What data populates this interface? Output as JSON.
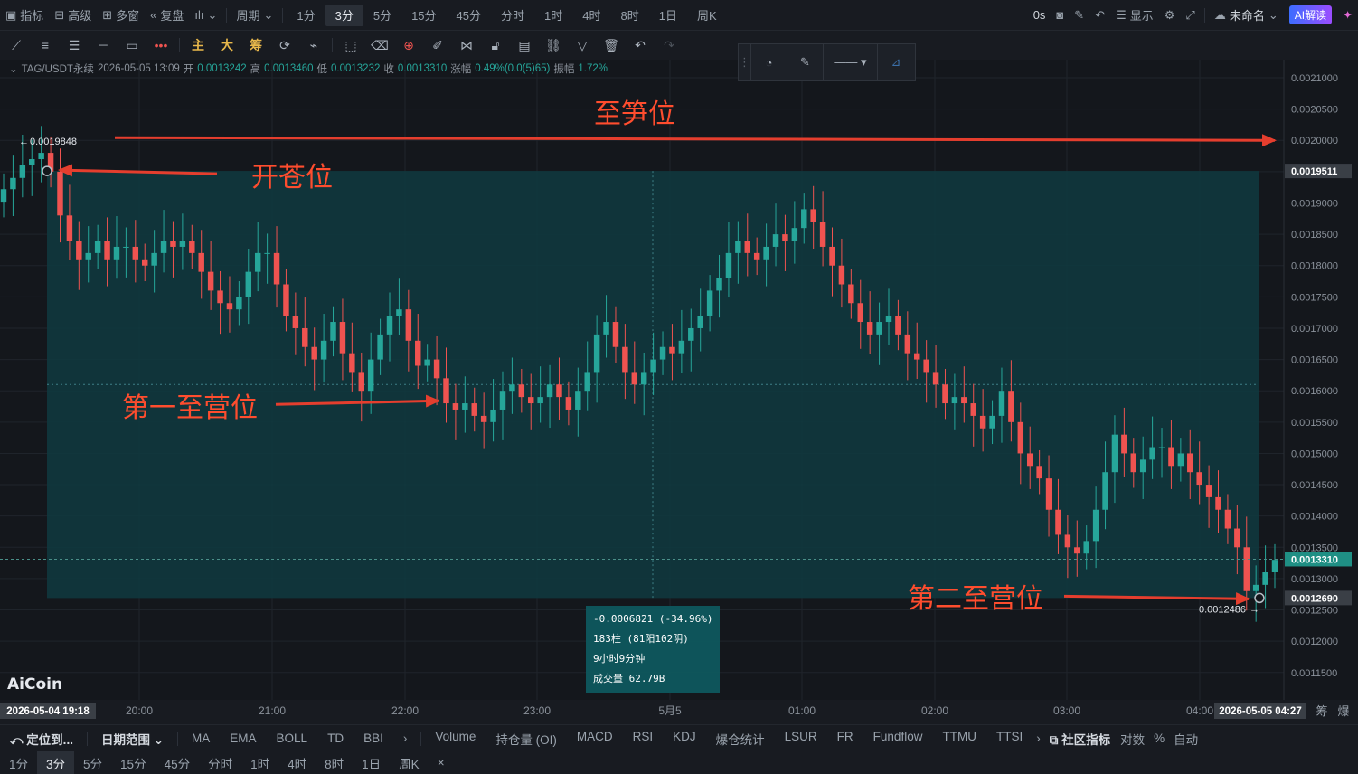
{
  "topbar": {
    "left_items": [
      "指标",
      "高级",
      "多窗",
      "复盘"
    ],
    "period_label": "周期",
    "timeframes": [
      "1分",
      "3分",
      "5分",
      "15分",
      "45分",
      "分时",
      "1时",
      "4时",
      "8时",
      "1日",
      "周K"
    ],
    "active_timeframe": "3分",
    "timer": "0s",
    "display_label": "显示",
    "unnamed_label": "未命名",
    "ai_label": "AI解读"
  },
  "toolbar": {
    "main_label": "主",
    "big_label": "大",
    "chip_label": "筹"
  },
  "ohlc": {
    "symbol": "TAG/USDT永续",
    "datetime": "2026-05-05 13:09",
    "open_label": "开",
    "open": "0.0013242",
    "high_label": "高",
    "high": "0.0013460",
    "low_label": "低",
    "low": "0.0013232",
    "close_label": "收",
    "close": "0.0013310",
    "change_label": "涨幅",
    "change": "0.49%(0.0(5)65)",
    "amp_label": "振幅",
    "amp": "1.72%"
  },
  "annotations": {
    "target": "至笋位",
    "entry": "开苍位",
    "first": "第一至营位",
    "second": "第二至营位"
  },
  "measure": {
    "delta": "-0.0006821 (-34.96%)",
    "bars": "183柱 (81阳102阴)",
    "duration": "9小时9分钟",
    "volume": "成交量 62.79B"
  },
  "watermark": "AiCoin",
  "chart_data": {
    "type": "candlestick",
    "y_axis_ticks": [
      "0.0021000",
      "0.0020500",
      "0.0020000",
      "0.0019500",
      "0.0019000",
      "0.0018500",
      "0.0018000",
      "0.0017500",
      "0.0017000",
      "0.0016500",
      "0.0016000",
      "0.0015500",
      "0.0015000",
      "0.0014500",
      "0.0014000",
      "0.0013500",
      "0.0013000",
      "0.0012500",
      "0.0012000",
      "0.0011500"
    ],
    "ylim": [
      0.00113,
      0.00215
    ],
    "x_axis_ticks": [
      "20:00",
      "21:00",
      "22:00",
      "23:00",
      "5月5",
      "01:00",
      "02:00",
      "03:00",
      "04:00"
    ],
    "x_start_label": "2026-05-04 19:18",
    "x_end_label": "2026-05-05 04:27",
    "price_labels": {
      "range_top": "0.0019511",
      "current": "0.0013310",
      "range_bottom": "0.0012690"
    },
    "high_marker": "0.0019848",
    "low_marker": "0.0012486",
    "range_top_value": 0.0019511,
    "range_bottom_value": 0.001269,
    "mid_value": 0.00161,
    "current_value": 0.001331,
    "target_value": 0.002,
    "high_value": 0.0019848,
    "low_value": 0.0012486,
    "closes": [
      0.001922,
      0.00194,
      0.00196,
      0.00197,
      0.00198,
      0.00195,
      0.00188,
      0.00184,
      0.00181,
      0.00182,
      0.00184,
      0.00181,
      0.00183,
      0.00183,
      0.00181,
      0.0018,
      0.00182,
      0.00184,
      0.00183,
      0.00184,
      0.00182,
      0.00179,
      0.00176,
      0.00174,
      0.00173,
      0.00175,
      0.00179,
      0.00182,
      0.00182,
      0.00177,
      0.00172,
      0.0017,
      0.00167,
      0.00165,
      0.00168,
      0.00171,
      0.00166,
      0.00163,
      0.0016,
      0.00165,
      0.00169,
      0.00172,
      0.00173,
      0.00168,
      0.00164,
      0.00165,
      0.00162,
      0.00158,
      0.00157,
      0.00158,
      0.00156,
      0.00155,
      0.00157,
      0.0016,
      0.00161,
      0.00159,
      0.00158,
      0.00159,
      0.00161,
      0.00159,
      0.00157,
      0.0016,
      0.00163,
      0.00169,
      0.00171,
      0.00167,
      0.00163,
      0.00161,
      0.00163,
      0.00165,
      0.00167,
      0.00166,
      0.00168,
      0.0017,
      0.00172,
      0.00176,
      0.00178,
      0.00182,
      0.00184,
      0.00182,
      0.00181,
      0.00183,
      0.00185,
      0.00184,
      0.00186,
      0.00189,
      0.00187,
      0.00183,
      0.0018,
      0.00177,
      0.00174,
      0.00171,
      0.00169,
      0.00171,
      0.00172,
      0.00169,
      0.00166,
      0.00165,
      0.00163,
      0.00161,
      0.00158,
      0.00159,
      0.00158,
      0.00156,
      0.00154,
      0.00156,
      0.0016,
      0.00155,
      0.0015,
      0.00148,
      0.00146,
      0.00141,
      0.00137,
      0.00135,
      0.00134,
      0.00136,
      0.00141,
      0.00147,
      0.00153,
      0.0015,
      0.00147,
      0.00149,
      0.00151,
      0.00151,
      0.00148,
      0.0015,
      0.00147,
      0.00145,
      0.00143,
      0.00141,
      0.00138,
      0.00135,
      0.00128,
      0.00129,
      0.00131,
      0.00133
    ]
  },
  "bottom": {
    "locate": "定位到...",
    "date_range": "日期范围",
    "indicators": [
      "MA",
      "EMA",
      "BOLL",
      "TD",
      "BBI"
    ],
    "sub_indicators": [
      "Volume",
      "持仓量 (OI)",
      "MACD",
      "RSI",
      "KDJ",
      "爆仓统计",
      "LSUR",
      "FR",
      "Fundflow",
      "TTMU",
      "TTSI"
    ],
    "community": "社区指标",
    "log": "对数",
    "pct": "%",
    "auto": "自动",
    "timeframes": [
      "1分",
      "3分",
      "5分",
      "15分",
      "45分",
      "分时",
      "1时",
      "4时",
      "8时",
      "1日",
      "周K"
    ],
    "active_tf": "3分",
    "side_a": "筹",
    "side_b": "爆"
  },
  "colors": {
    "up": "#26a69a",
    "down": "#ef5350",
    "range_fill": "#0f3a40",
    "arrow": "#e53e2e",
    "annotation": "#ff4d2e"
  }
}
